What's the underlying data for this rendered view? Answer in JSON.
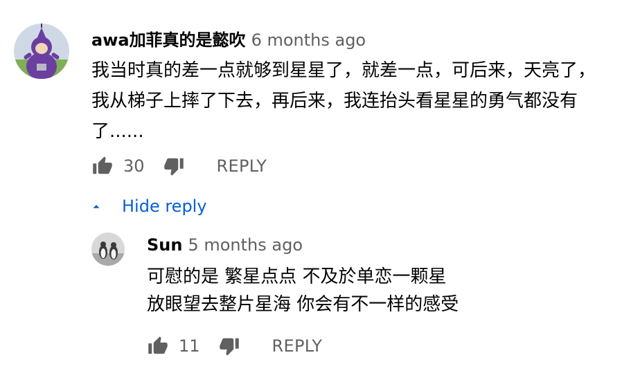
{
  "comment": {
    "author": "awa加菲真的是懿吹",
    "time": "6 months ago",
    "text_lines": [
      "我当时真的差一点就够到星星了，就差一点，可后来，天亮了，",
      "我从梯子上摔了下去，再后来，我连抬头看星星的勇气都没有",
      "了......"
    ],
    "likes": "30",
    "reply_label": "REPLY",
    "avatar_icon": "purple-teletubby-avatar"
  },
  "toggle": {
    "label": "Hide reply",
    "icon": "caret-up-icon",
    "color": "#065fd4"
  },
  "reply": {
    "author": "Sun",
    "time": "5 months ago",
    "text_lines": [
      "可慰的是 繁星点点 不及於单恋一颗星",
      "放眼望去整片星海 你会有不一样的感受"
    ],
    "likes": "11",
    "reply_label": "REPLY",
    "avatar_icon": "penguins-avatar"
  }
}
